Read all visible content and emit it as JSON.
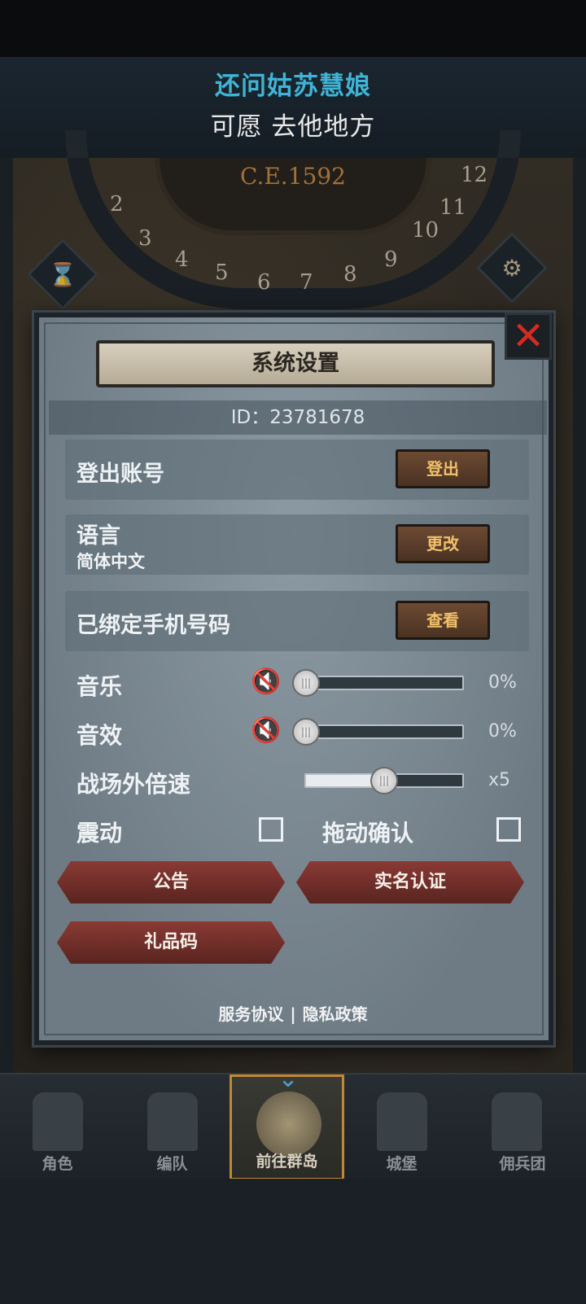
{
  "banner": {
    "line1": "还问姑苏慧娘",
    "line2": "可愿 去他地方"
  },
  "map": {
    "era": "C.E.1592",
    "dial_numbers": [
      "2",
      "3",
      "4",
      "5",
      "6",
      "7",
      "8",
      "9",
      "10",
      "11",
      "12"
    ]
  },
  "dialog": {
    "title": "系统设置",
    "id_text": "ID：23781678",
    "rows": [
      {
        "label": "登出账号",
        "button": "登出"
      },
      {
        "label": "语言",
        "sub": "简体中文",
        "button": "更改"
      },
      {
        "label": "已绑定手机号码",
        "button": "查看"
      }
    ],
    "music": {
      "label": "音乐",
      "value_text": "0%",
      "level": 0
    },
    "sfx": {
      "label": "音效",
      "value_text": "0%",
      "level": 0
    },
    "speed": {
      "label": "战场外倍速",
      "value_text": "x5",
      "level": 0.5
    },
    "vibrate": {
      "label": "震动",
      "checked": false
    },
    "drag_confirm": {
      "label": "拖动确认",
      "checked": false
    },
    "buttons": {
      "notice": "公告",
      "realname": "实名认证",
      "gift": "礼品码"
    },
    "links": {
      "terms": "服务协议",
      "sep": "|",
      "privacy": "隐私政策"
    }
  },
  "nav": {
    "items": [
      {
        "label": "角色"
      },
      {
        "label": "编队"
      },
      {
        "label": "前往群岛"
      },
      {
        "label": "城堡"
      },
      {
        "label": "佣兵团"
      }
    ],
    "active": 2
  },
  "colors": {
    "accent_orange": "#c2882e",
    "close_red": "#d52a22",
    "banner_blue": "#3fb4d6"
  }
}
